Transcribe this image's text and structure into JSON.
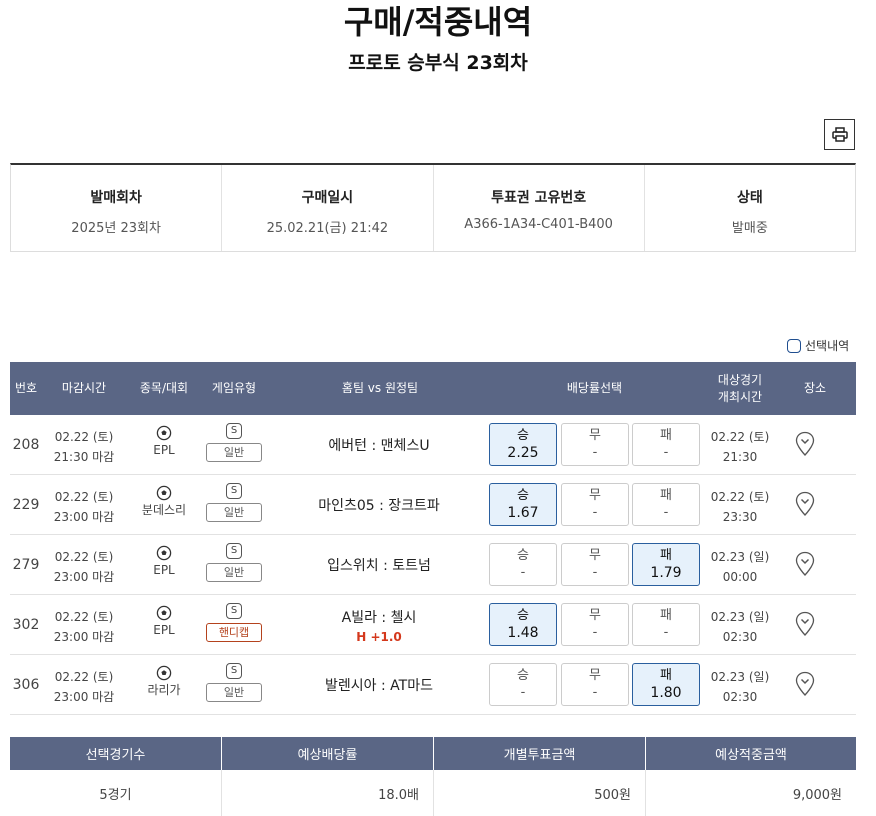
{
  "page": {
    "title": "구매/적중내역",
    "subtitle": "프로토 승부식 23회차"
  },
  "info": {
    "headers": [
      "발매회차",
      "구매일시",
      "투표권 고유번호",
      "상태"
    ],
    "values": [
      "2025년 23회차",
      "25.02.21(금) 21:42",
      "A366-1A34-C401-B400",
      "발매중"
    ]
  },
  "legend": {
    "selected": "선택내역"
  },
  "table": {
    "headers": {
      "num": "번호",
      "deadline": "마감시간",
      "sport": "종목/대회",
      "game_type": "게임유형",
      "teams": "홈팀 vs 원정팀",
      "odds": "배당률선택",
      "date_line1": "대상경기",
      "date_line2": "개최시간",
      "venue": "장소"
    },
    "rows": [
      {
        "num": "208",
        "deadline_date": "02.22 (토)",
        "deadline_time": "21:30 마감",
        "league": "EPL",
        "type_icon": "S",
        "type": "일반",
        "teams": "에버턴 : 맨체스U",
        "handicap": "",
        "win_label": "승",
        "win": "2.25",
        "draw_label": "무",
        "draw": "-",
        "lose_label": "패",
        "lose": "-",
        "selected": "win",
        "game_date": "02.22 (토)",
        "game_time": "21:30"
      },
      {
        "num": "229",
        "deadline_date": "02.22 (토)",
        "deadline_time": "23:00 마감",
        "league": "분데스리",
        "type_icon": "S",
        "type": "일반",
        "teams": "마인츠05 : 장크트파",
        "handicap": "",
        "win_label": "승",
        "win": "1.67",
        "draw_label": "무",
        "draw": "-",
        "lose_label": "패",
        "lose": "-",
        "selected": "win",
        "game_date": "02.22 (토)",
        "game_time": "23:30"
      },
      {
        "num": "279",
        "deadline_date": "02.22 (토)",
        "deadline_time": "23:00 마감",
        "league": "EPL",
        "type_icon": "S",
        "type": "일반",
        "teams": "입스위치 : 토트넘",
        "handicap": "",
        "win_label": "승",
        "win": "-",
        "draw_label": "무",
        "draw": "-",
        "lose_label": "패",
        "lose": "1.79",
        "selected": "lose",
        "game_date": "02.23 (일)",
        "game_time": "00:00"
      },
      {
        "num": "302",
        "deadline_date": "02.22 (토)",
        "deadline_time": "23:00 마감",
        "league": "EPL",
        "type_icon": "S",
        "type": "핸디캡",
        "teams": "A빌라 : 첼시",
        "handicap": "H +1.0",
        "win_label": "승",
        "win": "1.48",
        "draw_label": "무",
        "draw": "-",
        "lose_label": "패",
        "lose": "-",
        "selected": "win",
        "game_date": "02.23 (일)",
        "game_time": "02:30"
      },
      {
        "num": "306",
        "deadline_date": "02.22 (토)",
        "deadline_time": "23:00 마감",
        "league": "라리가",
        "type_icon": "S",
        "type": "일반",
        "teams": "발렌시아 : AT마드",
        "handicap": "",
        "win_label": "승",
        "win": "-",
        "draw_label": "무",
        "draw": "-",
        "lose_label": "패",
        "lose": "1.80",
        "selected": "lose",
        "game_date": "02.23 (일)",
        "game_time": "02:30"
      }
    ]
  },
  "summary": {
    "headers": [
      "선택경기수",
      "예상배당률",
      "개별투표금액",
      "예상적중금액"
    ],
    "values": [
      "5경기",
      "18.0배",
      "500원",
      "9,000원"
    ]
  },
  "colors": {
    "header_bg": "#5a6685",
    "selected_bg": "#e6f1fb",
    "selected_border": "#2a5f9e",
    "handicap": "#d4381c"
  }
}
